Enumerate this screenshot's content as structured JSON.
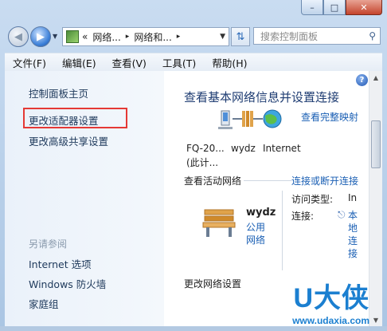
{
  "window": {
    "minimize": "–",
    "maximize": "□",
    "close": "✕"
  },
  "nav": {
    "address_segments": [
      "«",
      "网络...",
      "▸",
      "网络和...",
      "▸"
    ],
    "search_placeholder": "搜索控制面板"
  },
  "menu": [
    "文件(F)",
    "编辑(E)",
    "查看(V)",
    "工具(T)",
    "帮助(H)"
  ],
  "sidebar": {
    "home": "控制面板主页",
    "adapter": "更改适配器设置",
    "sharing": "更改高级共享设置",
    "see_also": "另请参阅",
    "internet_options": "Internet 选项",
    "firewall": "Windows 防火墙",
    "homegroup": "家庭组"
  },
  "main": {
    "title": "查看基本网络信息并设置连接",
    "full_map": "查看完整映射",
    "computer_line1": "FQ-20...",
    "computer_line2": "(此计...",
    "network_node": "wydz",
    "internet_node": "Internet",
    "active_networks": "查看活动网络",
    "connect_disconnect": "连接或断开连接",
    "network_name": "wydz",
    "network_type": "公用网络",
    "access_type_label": "访问类型:",
    "access_type_value": "In",
    "connections_label": "连接:",
    "connections_value": "本地连接",
    "change_settings": "更改网络设置"
  },
  "watermark": {
    "logo": "U大侠",
    "url": "www.udaxia.com"
  },
  "colors": {
    "link": "#1a5fb4",
    "highlight_border": "#e53935",
    "title": "#1e3c72"
  }
}
